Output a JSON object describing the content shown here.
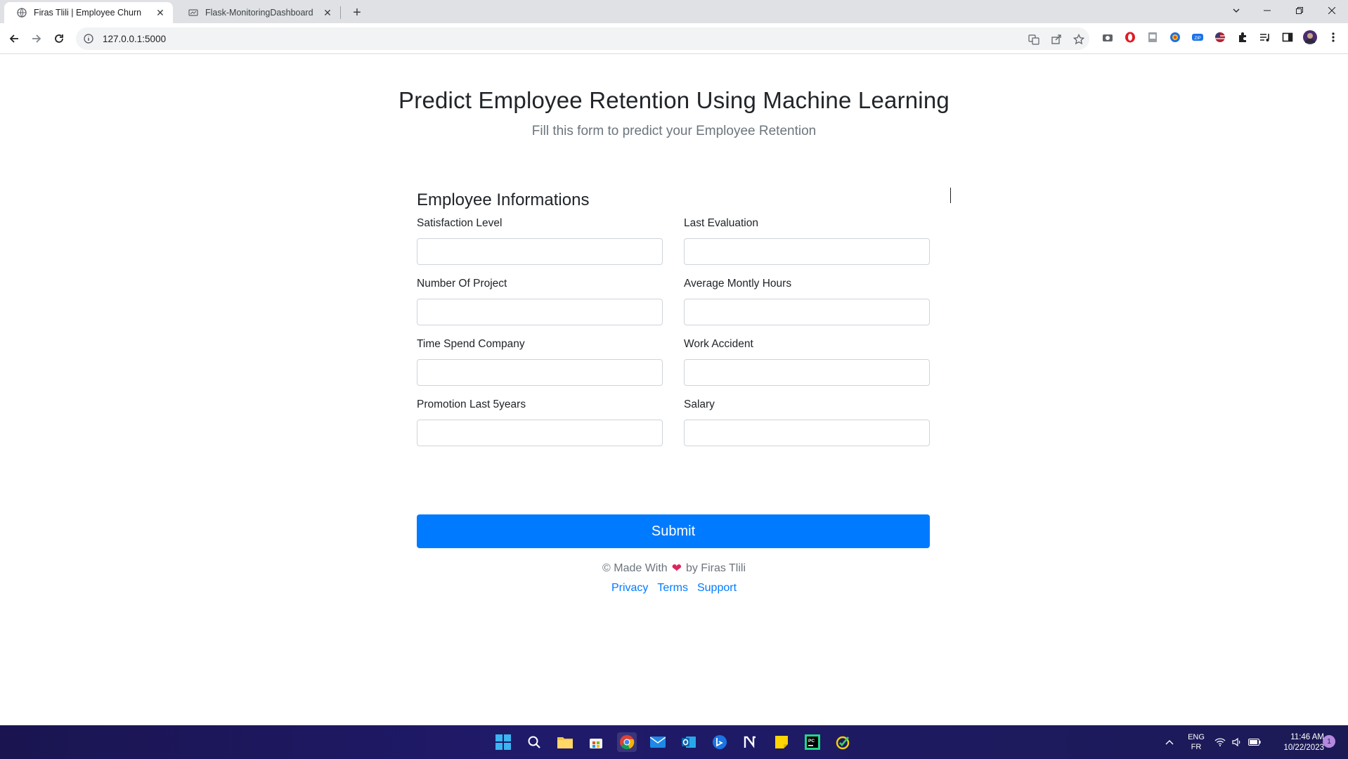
{
  "browser": {
    "tabs": [
      {
        "title": "Firas Tlili | Employee Churn",
        "active": true
      },
      {
        "title": "Flask-MonitoringDashboard",
        "active": false
      }
    ],
    "url": "127.0.0.1:5000"
  },
  "page": {
    "title": "Predict Employee Retention Using Machine Learning",
    "subtitle": "Fill this form to predict your Employee Retention",
    "form": {
      "section_title": "Employee Informations",
      "fields": [
        {
          "label": "Satisfaction Level",
          "value": ""
        },
        {
          "label": "Last Evaluation",
          "value": ""
        },
        {
          "label": "Number Of Project",
          "value": ""
        },
        {
          "label": "Average Montly Hours",
          "value": ""
        },
        {
          "label": "Time Spend Company",
          "value": ""
        },
        {
          "label": "Work Accident",
          "value": ""
        },
        {
          "label": "Promotion Last 5years",
          "value": ""
        },
        {
          "label": "Salary",
          "value": ""
        }
      ],
      "submit_label": "Submit"
    },
    "footer": {
      "made_with_prefix": "© Made With",
      "made_with_suffix": "by Firas Tlili",
      "links": [
        "Privacy",
        "Terms",
        "Support"
      ]
    }
  },
  "taskbar": {
    "lang_top": "ENG",
    "lang_bottom": "FR",
    "time": "11:46 AM",
    "date": "10/22/2023",
    "notification_count": "1"
  },
  "colors": {
    "primary": "#007bff",
    "heart": "#e0245e",
    "taskbar": "#1f1a66"
  }
}
